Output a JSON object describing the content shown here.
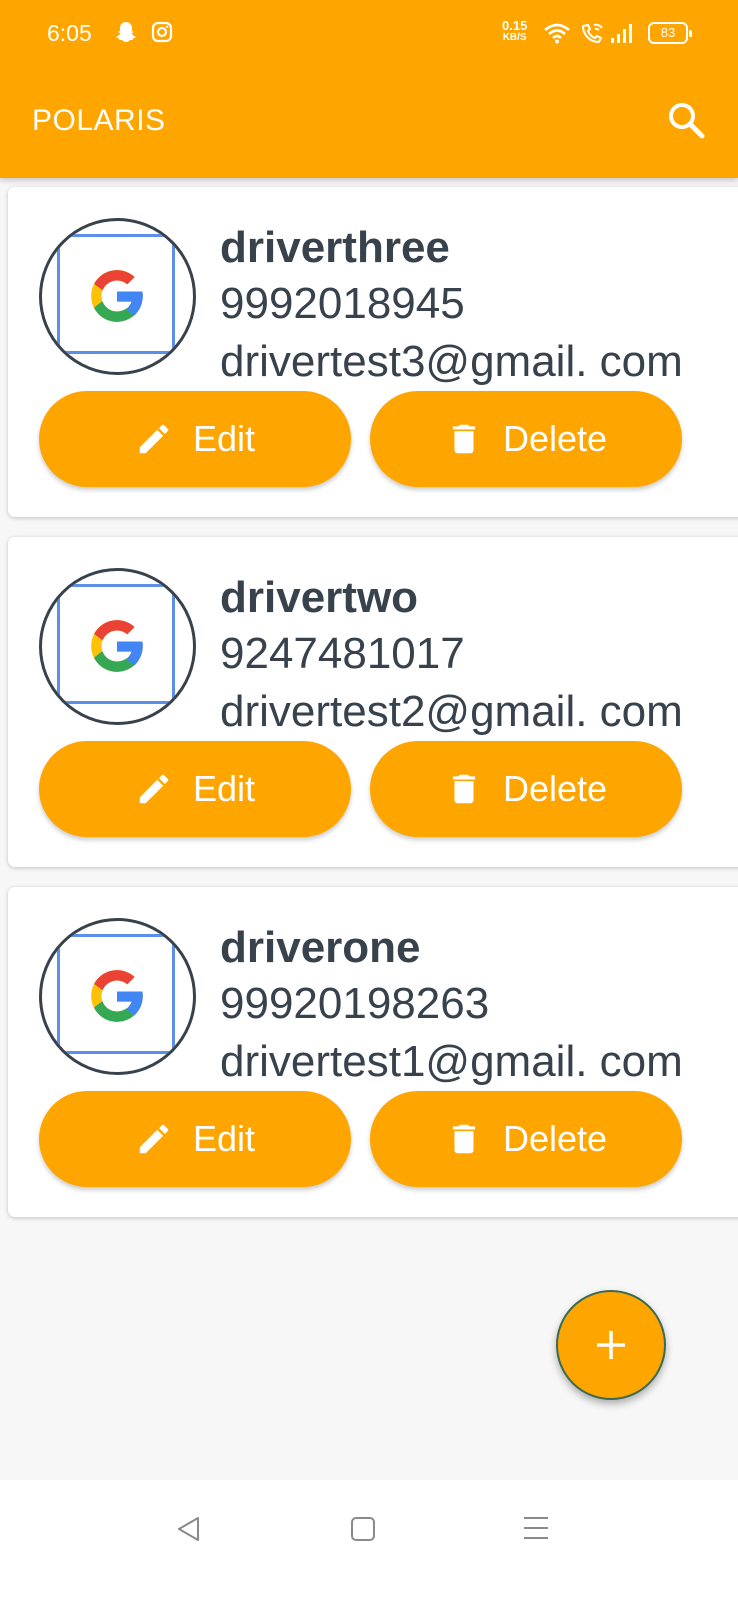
{
  "status_bar": {
    "time": "6:05",
    "net_speed_value": "0.15",
    "net_speed_unit": "KB/S",
    "battery": "83",
    "icons": [
      "snapchat-icon",
      "instagram-icon",
      "wifi-icon",
      "wifi-call-icon",
      "signal-icon",
      "battery-icon"
    ]
  },
  "app_bar": {
    "title": "POLARIS",
    "search_icon": "search-icon",
    "background_color": "#FFA500"
  },
  "drivers": [
    {
      "name": "driverthree",
      "phone": "9992018945",
      "email": "drivertest3@gmail. com",
      "edit_label": "Edit",
      "delete_label": "Delete"
    },
    {
      "name": "drivertwo",
      "phone": "9247481017",
      "email": "drivertest2@gmail. com",
      "edit_label": "Edit",
      "delete_label": "Delete"
    },
    {
      "name": "driverone",
      "phone": "99920198263",
      "email": "drivertest1@gmail. com",
      "edit_label": "Edit",
      "delete_label": "Delete"
    }
  ],
  "fab": {
    "icon": "plus-icon"
  },
  "nav_bar": {
    "icons": [
      "back-icon",
      "home-icon",
      "menu-icon"
    ]
  },
  "colors": {
    "accent": "#FFA500",
    "text": "#37424d"
  }
}
